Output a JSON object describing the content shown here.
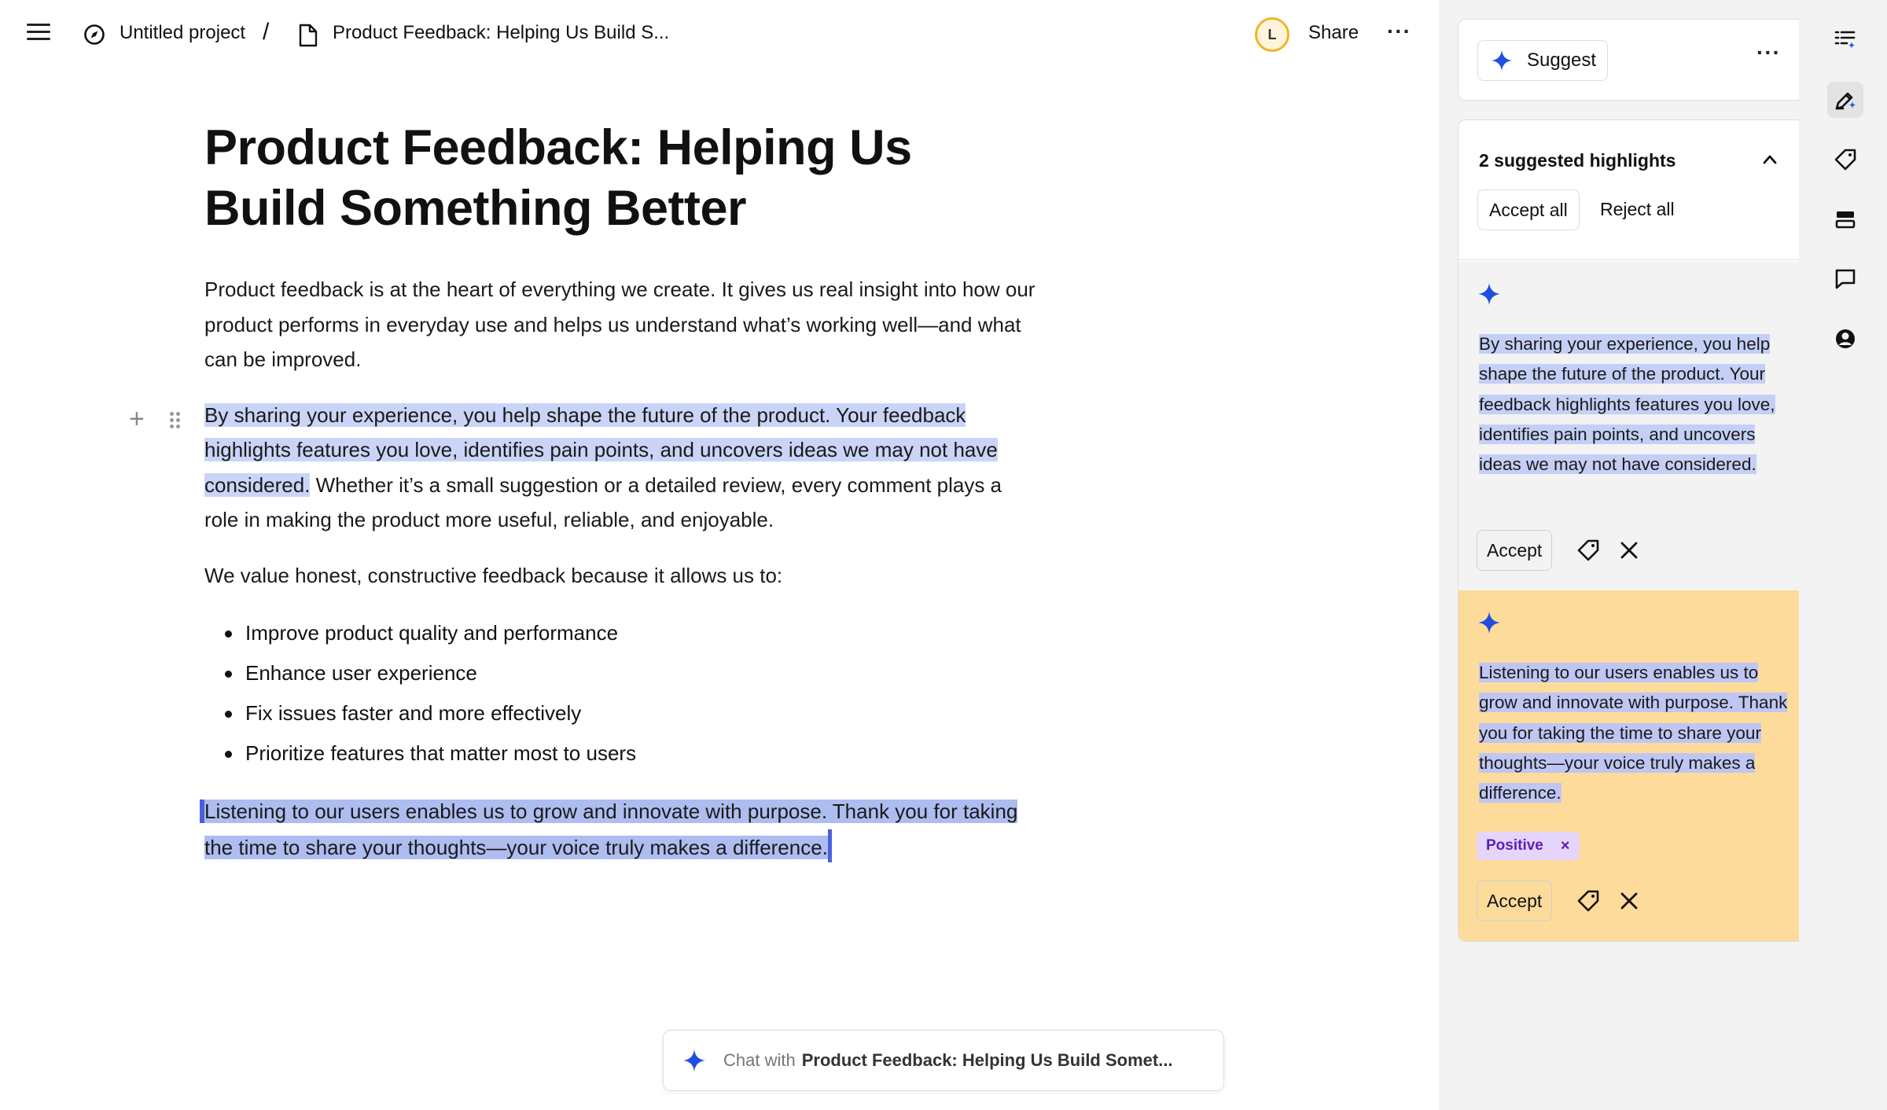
{
  "breadcrumb": {
    "project": "Untitled project",
    "separator": "/",
    "document": "Product Feedback: Helping Us Build S..."
  },
  "header": {
    "avatar_initial": "L",
    "share_label": "Share",
    "more_label": "···"
  },
  "document": {
    "title": "Product Feedback: Helping Us Build Something Better",
    "para1": "Product feedback is at the heart of everything we create. It gives us real insight into how our product performs in everyday use and helps us understand what’s working well—and what can be improved.",
    "para2_highlight": "By sharing your experience, you help shape the future of the product. Your feedback highlights features you love, identifies pain points, and uncovers ideas we may not have considered.",
    "para2_rest": " Whether it’s a small suggestion or a detailed review, every comment plays a role in making the product more useful, reliable, and enjoyable.",
    "para3": "We value honest, constructive feedback because it allows us to:",
    "bullets": [
      "Improve product quality and performance",
      "Enhance user experience",
      "Fix issues faster and more effectively",
      "Prioritize features that matter most to users"
    ],
    "para4_highlight": "Listening to our users enables us to grow and innovate with purpose. Thank you for taking the time to share your thoughts—your voice truly makes a difference."
  },
  "chat": {
    "prefix": "Chat with",
    "document": "Product Feedback: Helping Us Build Somet..."
  },
  "panel": {
    "suggest_label": "Suggest",
    "more_label": "···",
    "count_label": "2 suggested highlights",
    "accept_all_label": "Accept all",
    "reject_all_label": "Reject all",
    "suggestions": [
      {
        "text": "By sharing your experience, you help shape the future of the product. Your feedback highlights features you love, identifies pain points, and uncovers ideas we may not have considered.",
        "accept_label": "Accept"
      },
      {
        "text": "Listening to our users enables us to grow and innovate with purpose. Thank you for taking the time to share your thoughts—your voice truly makes a difference.",
        "tag": "Positive",
        "tag_remove": "×",
        "accept_label": "Accept"
      }
    ]
  },
  "colors": {
    "accent_blue": "#1f4fe0",
    "highlight": "#c9d4f7",
    "selected_card": "#fddb9b",
    "tag_bg": "#e5d5fb",
    "tag_text": "#5b21b6"
  }
}
